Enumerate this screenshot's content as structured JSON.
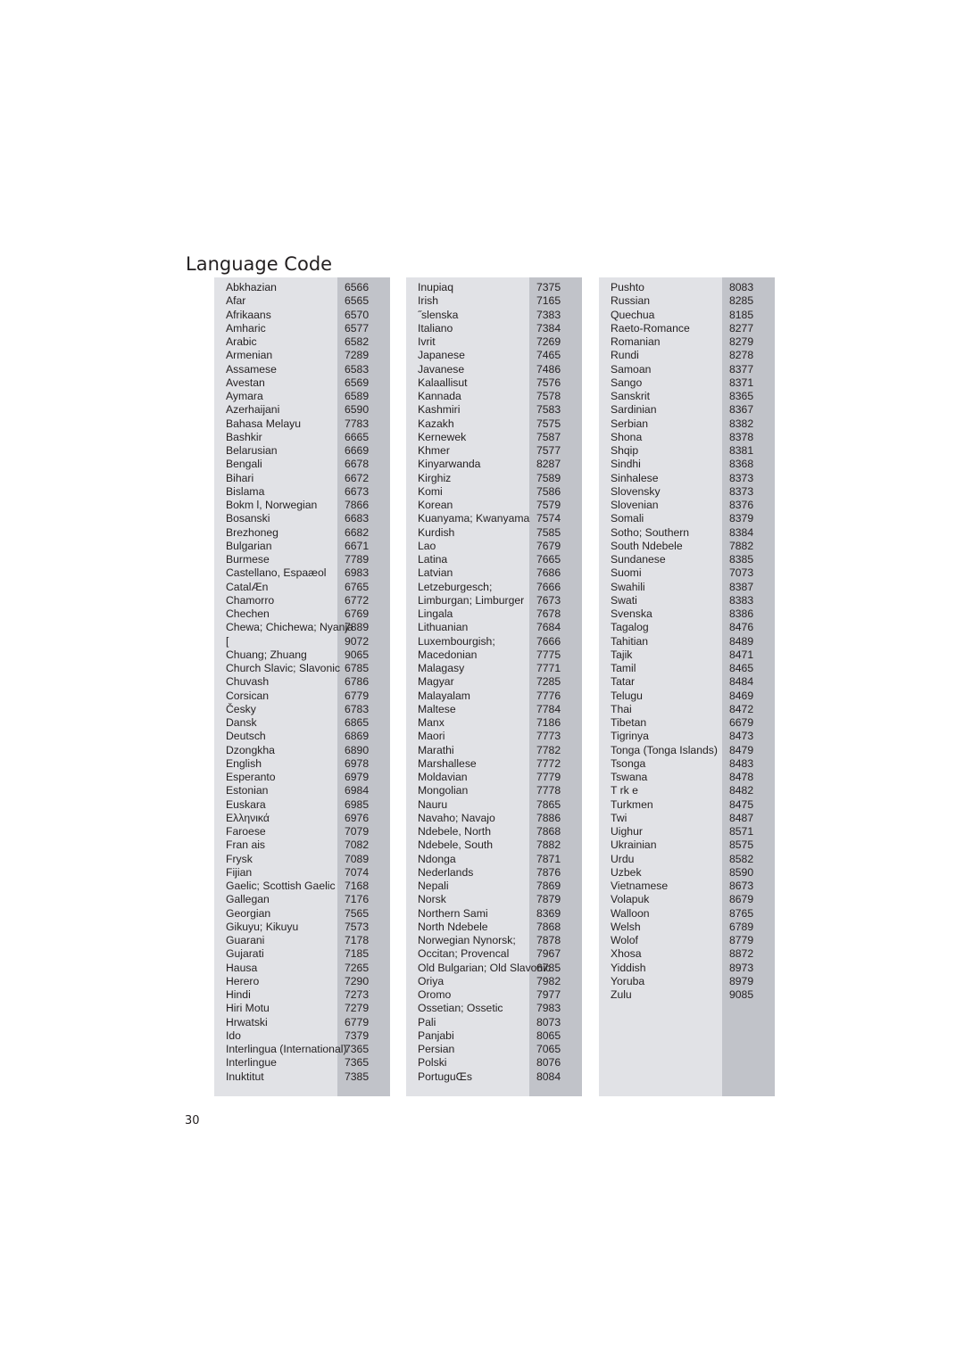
{
  "page": {
    "title": "Language Code",
    "page_number": "30"
  },
  "colors": {
    "panel_background": "#e1e2e6",
    "code_column_background": "#c1c3c9",
    "text": "#231f20"
  },
  "columns": [
    {
      "rows": [
        {
          "name": "Abkhazian",
          "code": "6566"
        },
        {
          "name": "Afar",
          "code": "6565"
        },
        {
          "name": "Afrikaans",
          "code": "6570"
        },
        {
          "name": "Amharic",
          "code": "6577"
        },
        {
          "name": "Arabic",
          "code": "6582"
        },
        {
          "name": "Armenian",
          "code": "7289"
        },
        {
          "name": "Assamese",
          "code": "6583"
        },
        {
          "name": "Avestan",
          "code": "6569"
        },
        {
          "name": "Aymara",
          "code": "6589"
        },
        {
          "name": "Azerhaijani",
          "code": "6590"
        },
        {
          "name": "Bahasa Melayu",
          "code": "7783"
        },
        {
          "name": "Bashkir",
          "code": "6665"
        },
        {
          "name": "Belarusian",
          "code": "6669"
        },
        {
          "name": "Bengali",
          "code": "6678"
        },
        {
          "name": "Bihari",
          "code": "6672"
        },
        {
          "name": "Bislama",
          "code": "6673"
        },
        {
          "name": "Bokm l, Norwegian",
          "code": "7866"
        },
        {
          "name": "Bosanski",
          "code": "6683"
        },
        {
          "name": "Brezhoneg",
          "code": "6682"
        },
        {
          "name": "Bulgarian",
          "code": "6671"
        },
        {
          "name": "Burmese",
          "code": "7789"
        },
        {
          "name": "Castellano, Espaæol",
          "code": "6983"
        },
        {
          "name": "CatalÆn",
          "code": "6765"
        },
        {
          "name": "Chamorro",
          "code": "6772"
        },
        {
          "name": "Chechen",
          "code": "6769"
        },
        {
          "name": "Chewa; Chichewa; Nyanja",
          "code": "7889"
        },
        {
          "name": "  [",
          "code": "9072"
        },
        {
          "name": "Chuang; Zhuang",
          "code": "9065"
        },
        {
          "name": "Church Slavic; Slavonic",
          "code": "6785"
        },
        {
          "name": "Chuvash",
          "code": "6786"
        },
        {
          "name": "Corsican",
          "code": "6779"
        },
        {
          "name": "Česky",
          "code": "6783"
        },
        {
          "name": "Dansk",
          "code": "6865"
        },
        {
          "name": "Deutsch",
          "code": "6869"
        },
        {
          "name": "Dzongkha",
          "code": "6890"
        },
        {
          "name": "English",
          "code": "6978"
        },
        {
          "name": "Esperanto",
          "code": "6979"
        },
        {
          "name": "Estonian",
          "code": "6984"
        },
        {
          "name": "Euskara",
          "code": "6985"
        },
        {
          "name": "Ελληνικά",
          "code": "6976"
        },
        {
          "name": "Faroese",
          "code": "7079"
        },
        {
          "name": "Fran ais",
          "code": "7082"
        },
        {
          "name": "Frysk",
          "code": "7089"
        },
        {
          "name": "Fijian",
          "code": "7074"
        },
        {
          "name": "Gaelic; Scottish Gaelic",
          "code": "7168"
        },
        {
          "name": "Gallegan",
          "code": "7176"
        },
        {
          "name": "Georgian",
          "code": "7565"
        },
        {
          "name": "Gikuyu; Kikuyu",
          "code": "7573"
        },
        {
          "name": "Guarani",
          "code": "7178"
        },
        {
          "name": "Gujarati",
          "code": "7185"
        },
        {
          "name": "Hausa",
          "code": "7265"
        },
        {
          "name": "Herero",
          "code": "7290"
        },
        {
          "name": "Hindi",
          "code": "7273"
        },
        {
          "name": "Hiri Motu",
          "code": "7279"
        },
        {
          "name": "Hrwatski",
          "code": "6779"
        },
        {
          "name": "Ido",
          "code": "7379"
        },
        {
          "name": "Interlingua (International)",
          "code": "7365"
        },
        {
          "name": "Interlingue",
          "code": "7365"
        },
        {
          "name": "Inuktitut",
          "code": "7385"
        }
      ]
    },
    {
      "rows": [
        {
          "name": "Inupiaq",
          "code": "7375"
        },
        {
          "name": "Irish",
          "code": "7165"
        },
        {
          "name": "˝slenska",
          "code": "7383"
        },
        {
          "name": "Italiano",
          "code": "7384"
        },
        {
          "name": "Ivrit",
          "code": "7269"
        },
        {
          "name": "Japanese",
          "code": "7465"
        },
        {
          "name": "Javanese",
          "code": "7486"
        },
        {
          "name": "Kalaallisut",
          "code": "7576"
        },
        {
          "name": "Kannada",
          "code": "7578"
        },
        {
          "name": "Kashmiri",
          "code": "7583"
        },
        {
          "name": "Kazakh",
          "code": "7575"
        },
        {
          "name": "Kernewek",
          "code": "7587"
        },
        {
          "name": "Khmer",
          "code": "7577"
        },
        {
          "name": "Kinyarwanda",
          "code": "8287"
        },
        {
          "name": "Kirghiz",
          "code": "7589"
        },
        {
          "name": "Komi",
          "code": "7586"
        },
        {
          "name": "Korean",
          "code": "7579"
        },
        {
          "name": "Kuanyama; Kwanyama",
          "code": "7574"
        },
        {
          "name": "Kurdish",
          "code": "7585"
        },
        {
          "name": "Lao",
          "code": "7679"
        },
        {
          "name": "Latina",
          "code": "7665"
        },
        {
          "name": "Latvian",
          "code": "7686"
        },
        {
          "name": "Letzeburgesch;",
          "code": "7666"
        },
        {
          "name": "Limburgan; Limburger",
          "code": "7673"
        },
        {
          "name": "Lingala",
          "code": "7678"
        },
        {
          "name": "Lithuanian",
          "code": "7684"
        },
        {
          "name": "Luxembourgish;",
          "code": "7666"
        },
        {
          "name": "Macedonian",
          "code": "7775"
        },
        {
          "name": "Malagasy",
          "code": "7771"
        },
        {
          "name": "Magyar",
          "code": "7285"
        },
        {
          "name": "Malayalam",
          "code": "7776"
        },
        {
          "name": "Maltese",
          "code": "7784"
        },
        {
          "name": "Manx",
          "code": "7186"
        },
        {
          "name": "Maori",
          "code": "7773"
        },
        {
          "name": "Marathi",
          "code": "7782"
        },
        {
          "name": "Marshallese",
          "code": "7772"
        },
        {
          "name": "Moldavian",
          "code": "7779"
        },
        {
          "name": "Mongolian",
          "code": "7778"
        },
        {
          "name": "Nauru",
          "code": "7865"
        },
        {
          "name": "Navaho; Navajo",
          "code": "7886"
        },
        {
          "name": "Ndebele, North",
          "code": "7868"
        },
        {
          "name": "Ndebele, South",
          "code": "7882"
        },
        {
          "name": "Ndonga",
          "code": "7871"
        },
        {
          "name": "Nederlands",
          "code": "7876"
        },
        {
          "name": "Nepali",
          "code": "7869"
        },
        {
          "name": "Norsk",
          "code": "7879"
        },
        {
          "name": "Northern Sami",
          "code": "8369"
        },
        {
          "name": "North Ndebele",
          "code": "7868"
        },
        {
          "name": "Norwegian Nynorsk;",
          "code": "7878"
        },
        {
          "name": "Occitan; Provencal",
          "code": "7967"
        },
        {
          "name": "Old Bulgarian; Old Slavonic",
          "code": "6785"
        },
        {
          "name": "Oriya",
          "code": "7982"
        },
        {
          "name": "Oromo",
          "code": "7977"
        },
        {
          "name": "Ossetian; Ossetic",
          "code": "7983"
        },
        {
          "name": "Pali",
          "code": "8073"
        },
        {
          "name": "Panjabi",
          "code": "8065"
        },
        {
          "name": "Persian",
          "code": "7065"
        },
        {
          "name": "Polski",
          "code": "8076"
        },
        {
          "name": "PortuguŒs",
          "code": "8084"
        }
      ]
    },
    {
      "rows": [
        {
          "name": "Pushto",
          "code": "8083"
        },
        {
          "name": "Russian",
          "code": "8285"
        },
        {
          "name": "Quechua",
          "code": "8185"
        },
        {
          "name": "Raeto-Romance",
          "code": "8277"
        },
        {
          "name": "Romanian",
          "code": "8279"
        },
        {
          "name": "Rundi",
          "code": "8278"
        },
        {
          "name": "Samoan",
          "code": "8377"
        },
        {
          "name": "Sango",
          "code": "8371"
        },
        {
          "name": "Sanskrit",
          "code": "8365"
        },
        {
          "name": "Sardinian",
          "code": "8367"
        },
        {
          "name": "Serbian",
          "code": "8382"
        },
        {
          "name": "Shona",
          "code": "8378"
        },
        {
          "name": "Shqip",
          "code": "8381"
        },
        {
          "name": "Sindhi",
          "code": "8368"
        },
        {
          "name": "Sinhalese",
          "code": "8373"
        },
        {
          "name": "Slovensky",
          "code": "8373"
        },
        {
          "name": "Slovenian",
          "code": "8376"
        },
        {
          "name": "Somali",
          "code": "8379"
        },
        {
          "name": "Sotho; Southern",
          "code": "8384"
        },
        {
          "name": "South Ndebele",
          "code": "7882"
        },
        {
          "name": "Sundanese",
          "code": "8385"
        },
        {
          "name": "Suomi",
          "code": "7073"
        },
        {
          "name": "Swahili",
          "code": "8387"
        },
        {
          "name": "Swati",
          "code": "8383"
        },
        {
          "name": "Svenska",
          "code": "8386"
        },
        {
          "name": "Tagalog",
          "code": "8476"
        },
        {
          "name": "Tahitian",
          "code": "8489"
        },
        {
          "name": "Tajik",
          "code": "8471"
        },
        {
          "name": "Tamil",
          "code": "8465"
        },
        {
          "name": "Tatar",
          "code": "8484"
        },
        {
          "name": "Telugu",
          "code": "8469"
        },
        {
          "name": "Thai",
          "code": "8472"
        },
        {
          "name": "Tibetan",
          "code": "6679"
        },
        {
          "name": "Tigrinya",
          "code": "8473"
        },
        {
          "name": "Tonga (Tonga Islands)",
          "code": "8479"
        },
        {
          "name": "Tsonga",
          "code": "8483"
        },
        {
          "name": "Tswana",
          "code": "8478"
        },
        {
          "name": "T rk e",
          "code": "8482"
        },
        {
          "name": "Turkmen",
          "code": "8475"
        },
        {
          "name": "Twi",
          "code": "8487"
        },
        {
          "name": "Uighur",
          "code": "8571"
        },
        {
          "name": "Ukrainian",
          "code": "8575"
        },
        {
          "name": "Urdu",
          "code": "8582"
        },
        {
          "name": "Uzbek",
          "code": "8590"
        },
        {
          "name": "Vietnamese",
          "code": "8673"
        },
        {
          "name": "Volapuk",
          "code": "8679"
        },
        {
          "name": "Walloon",
          "code": "8765"
        },
        {
          "name": "Welsh",
          "code": "6789"
        },
        {
          "name": "Wolof",
          "code": "8779"
        },
        {
          "name": "Xhosa",
          "code": "8872"
        },
        {
          "name": "Yiddish",
          "code": "8973"
        },
        {
          "name": "Yoruba",
          "code": "8979"
        },
        {
          "name": "Zulu",
          "code": "9085"
        }
      ]
    }
  ]
}
